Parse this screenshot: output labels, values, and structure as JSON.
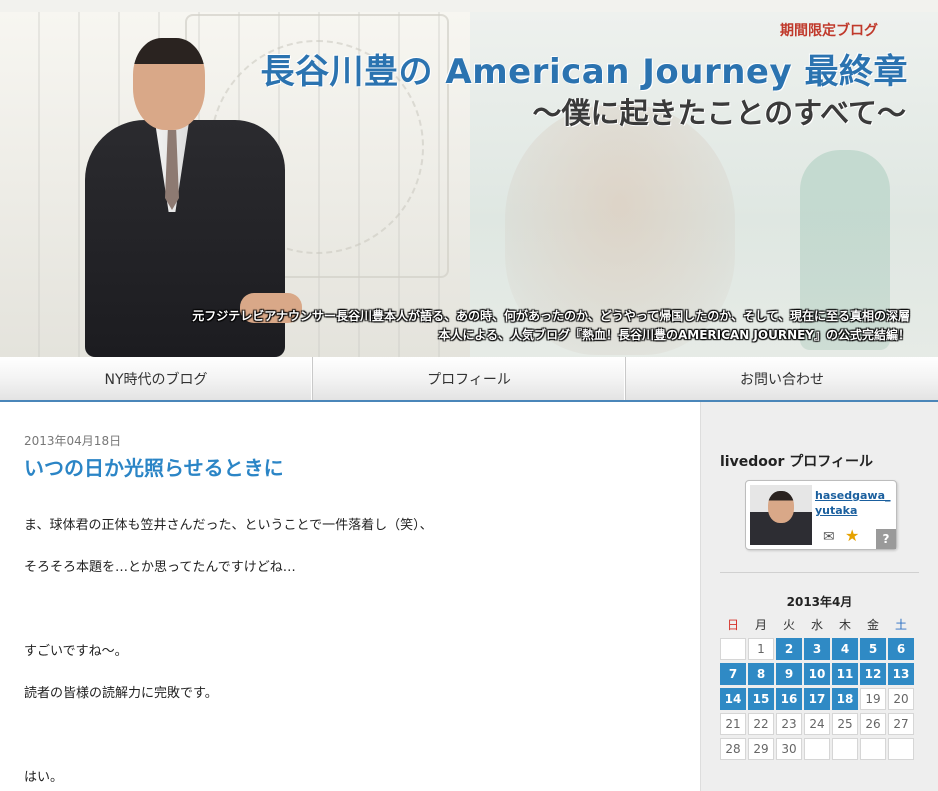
{
  "header": {
    "badge": "期間限定ブログ",
    "title": "長谷川豊の American Journey 最終章",
    "subtitle": "～僕に起きたことのすべて～",
    "desc_line1": "元フジテレビアナウンサー長谷川豊本人が語る、あの時、何があったのか、どうやって帰国したのか、そして、現在に至る真相の深層",
    "desc_line2": "本人による、人気ブログ『熱血！長谷川豊のAMERICAN JOURNEY』の公式完結編！"
  },
  "nav": {
    "items": [
      "NY時代のブログ",
      "プロフィール",
      "お問い合わせ"
    ]
  },
  "post": {
    "date": "2013年04月18日",
    "title": "いつの日か光照らせるときに",
    "paragraphs": [
      "ま、球体君の正体も笠井さんだった、ということで一件落着し（笑）、",
      "そろそろ本題を…とか思ってたんですけどね…",
      "すごいですね～。",
      "読者の皆様の読解力に完敗です。",
      "はい。"
    ]
  },
  "sidebar": {
    "profile_heading": "livedoor プロフィール",
    "username": "hasedgawa_yutaka",
    "help_label": "?",
    "icons": [
      "mail-icon",
      "star-icon"
    ],
    "calendar": {
      "title": "2013年4月",
      "weekdays": [
        "日",
        "月",
        "火",
        "水",
        "木",
        "金",
        "土"
      ],
      "weeks": [
        [
          "",
          "1",
          "2",
          "3",
          "4",
          "5",
          "6"
        ],
        [
          "7",
          "8",
          "9",
          "10",
          "11",
          "12",
          "13"
        ],
        [
          "14",
          "15",
          "16",
          "17",
          "18",
          "19",
          "20"
        ],
        [
          "21",
          "22",
          "23",
          "24",
          "25",
          "26",
          "27"
        ],
        [
          "28",
          "29",
          "30",
          "",
          "",
          "",
          ""
        ]
      ],
      "linked_days": [
        "2",
        "3",
        "4",
        "5",
        "6",
        "7",
        "8",
        "9",
        "10",
        "11",
        "12",
        "13",
        "14",
        "15",
        "16",
        "17",
        "18"
      ]
    }
  },
  "colors": {
    "accent_blue": "#2f8ac5",
    "title_blue": "#2b73b0",
    "badge_red": "#c0392b",
    "sunday_red": "#d6322a",
    "saturday_blue": "#2b6fc4"
  }
}
